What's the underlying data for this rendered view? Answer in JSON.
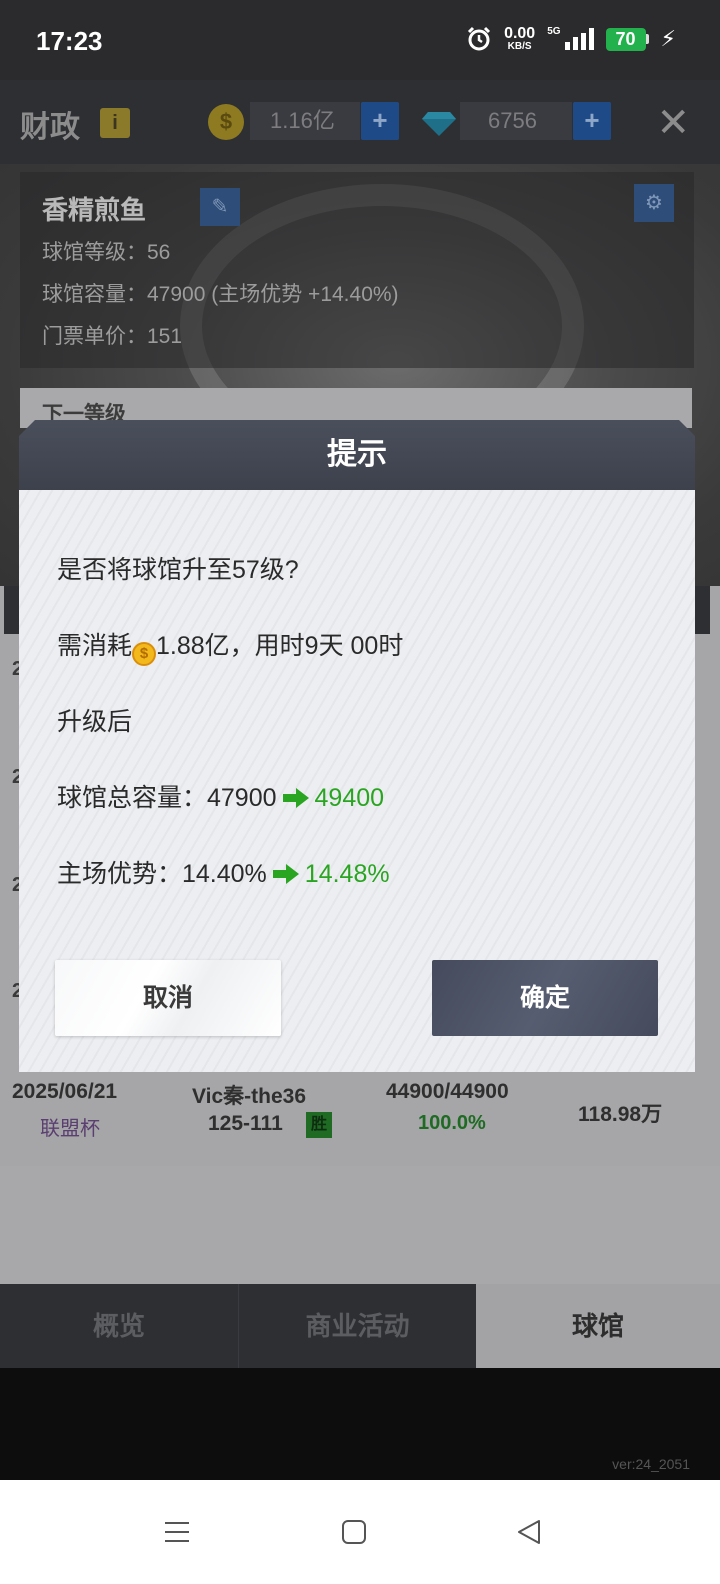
{
  "status_bar": {
    "time": "17:23",
    "net_speed": "0.00",
    "net_unit": "KB/S",
    "network": "5G",
    "battery": "70"
  },
  "game": {
    "header": {
      "title": "财政",
      "info_label": "i",
      "coins": "1.16亿",
      "diamonds": "6756",
      "plus": "+",
      "close": "✕"
    },
    "stadium": {
      "name": "香精煎鱼",
      "level": "球馆等级：56",
      "capacity": "球馆容量：47900 (主场优势 +14.40%)",
      "ticket_price": "门票单价：151",
      "next_level": "下一等级"
    },
    "partial_rows": [
      "2",
      "2",
      "2",
      "2"
    ],
    "last_row": {
      "date": "2025/06/21",
      "competition": "联盟杯",
      "opponent": "Vic秦-the36",
      "score": "125-111",
      "result": "胜",
      "attendance": "44900/44900",
      "attendance_pct": "100.0%",
      "revenue": "118.98万"
    },
    "tabs": [
      "概览",
      "商业活动",
      "球馆"
    ],
    "version": "ver:24_2051"
  },
  "dialog": {
    "title": "提示",
    "question": "是否将球馆升至57级?",
    "cost_prefix": "需消耗",
    "cost_suffix": "1.88亿，用时9天 00时",
    "after_label": "升级后",
    "capacity_label": "球馆总容量：47900",
    "capacity_new": "49400",
    "advantage_label": "主场优势：14.40%",
    "advantage_new": "14.48%",
    "cancel": "取消",
    "confirm": "确定"
  },
  "colors": {
    "accent_green": "#2aa521",
    "dialog_header": "#454a57",
    "confirm_button": "#4e5567"
  },
  "icons": [
    "alarm-icon",
    "signal-icon",
    "battery-icon",
    "charging-icon",
    "info-icon",
    "coin-icon",
    "diamond-icon",
    "close-icon",
    "edit-icon",
    "arrow-right-icon",
    "menu-icon",
    "home-icon",
    "back-icon"
  ]
}
